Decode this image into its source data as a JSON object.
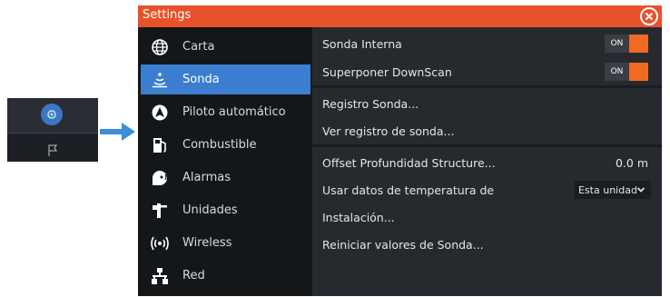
{
  "window": {
    "title": "Settings"
  },
  "colors": {
    "titlebar": "#e8522a",
    "active": "#3b7ecf",
    "toggle_knob": "#f06a23"
  },
  "sidebar": {
    "items": [
      {
        "label": "Carta",
        "icon": "globe-icon",
        "active": false
      },
      {
        "label": "Sonda",
        "icon": "sonar-icon",
        "active": true
      },
      {
        "label": "Piloto automático",
        "icon": "autopilot-icon",
        "active": false
      },
      {
        "label": "Combustible",
        "icon": "fuel-pump-icon",
        "active": false
      },
      {
        "label": "Alarmas",
        "icon": "alarm-icon",
        "active": false
      },
      {
        "label": "Unidades",
        "icon": "units-icon",
        "active": false
      },
      {
        "label": "Wireless",
        "icon": "wireless-icon",
        "active": false
      },
      {
        "label": "Red",
        "icon": "network-icon",
        "active": false
      }
    ]
  },
  "main": {
    "rows": [
      {
        "label": "Sonda Interna",
        "control": "toggle",
        "state": "ON"
      },
      {
        "label": "Superponer DownScan",
        "control": "toggle",
        "state": "ON"
      },
      {
        "label": "Registro Sonda..."
      },
      {
        "label": "Ver registro de sonda..."
      },
      {
        "label": "Offset Profundidad Structure...",
        "value": "0.0 m"
      },
      {
        "label": "Usar datos de temperatura de",
        "select": "Esta unidad"
      },
      {
        "label": "Instalación..."
      },
      {
        "label": "Reiniciar valores de Sonda..."
      }
    ]
  }
}
